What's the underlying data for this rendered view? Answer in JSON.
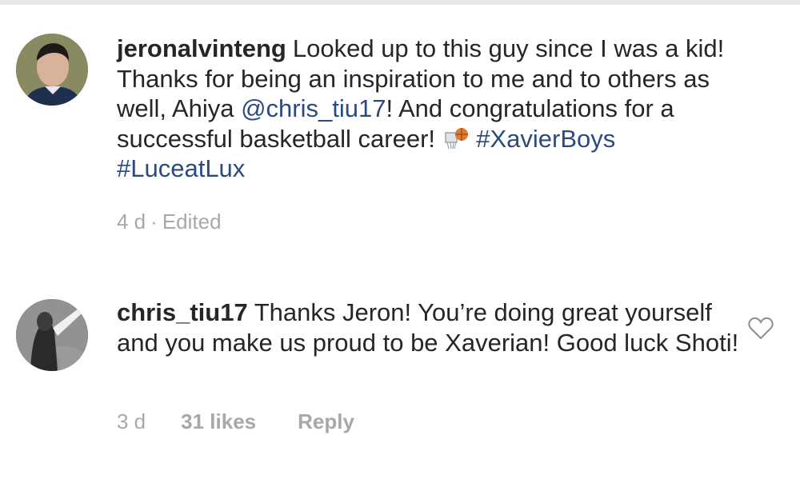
{
  "comments": [
    {
      "username": "jeronalvinteng",
      "text_parts": {
        "pre_mention": "Looked up to this guy since I was a kid! Thanks for being an inspiration to me and to others as well, Ahiya ",
        "mention": "@chris_tiu17",
        "post_mention": "! And congratulations for a successful basketball career! ",
        "hashtag1": "#XavierBoys",
        "hashtag2": "#LuceatLux"
      },
      "emoji_icon": "basketball-hoop-icon",
      "time": "4 d",
      "separator": "·",
      "edited": "Edited"
    },
    {
      "username": "chris_tiu17",
      "text": "Thanks Jeron! You’re doing great yourself and you make us proud to be Xaverian! Good luck Shoti!",
      "time": "3 d",
      "likes": "31 likes",
      "reply_label": "Reply",
      "like_icon": "heart-outline-icon"
    }
  ],
  "colors": {
    "text": "#262626",
    "link": "#2b4b80",
    "meta": "#a8a8a8"
  }
}
